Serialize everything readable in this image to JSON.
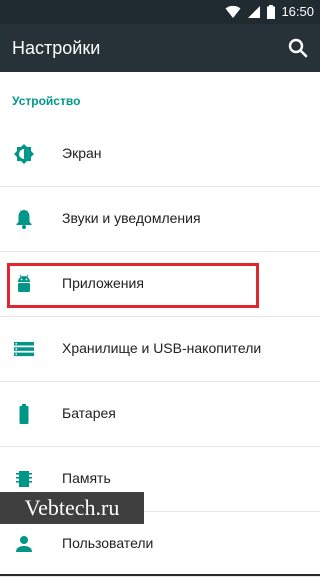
{
  "status_bar": {
    "time": "16:50",
    "icons": [
      "wifi-icon",
      "signal-icon",
      "battery-icon"
    ]
  },
  "toolbar": {
    "title": "Настройки",
    "search_icon": "search-icon"
  },
  "section": {
    "title": "Устройство"
  },
  "items": [
    {
      "label": "Экран",
      "icon": "brightness-icon"
    },
    {
      "label": "Звуки и уведомления",
      "icon": "bell-icon"
    },
    {
      "label": "Приложения",
      "icon": "android-icon"
    },
    {
      "label": "Хранилище и USB-накопители",
      "icon": "storage-icon"
    },
    {
      "label": "Батарея",
      "icon": "battery-icon"
    },
    {
      "label": "Память",
      "icon": "memory-icon"
    },
    {
      "label": "Пользователи",
      "icon": "person-icon"
    }
  ],
  "watermark": {
    "text": "Vebtech.ru"
  },
  "colors": {
    "status_bar": "#1f2b30",
    "toolbar": "#263238",
    "accent": "#009688",
    "highlight": "#e0262f"
  }
}
